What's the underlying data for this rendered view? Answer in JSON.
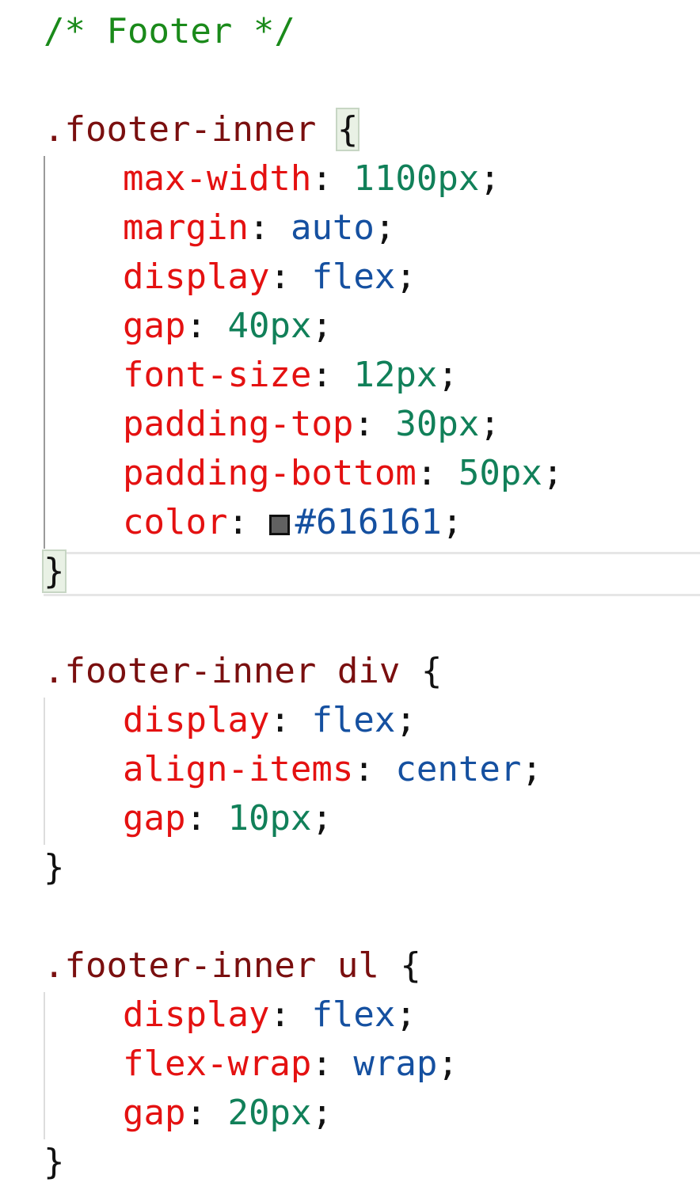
{
  "comment": "/* Footer */",
  "colors": {
    "comment": "#1a8a1a",
    "selector": "#7a0f0f",
    "property": "#e41111",
    "number": "#118059",
    "keyword": "#1550a0",
    "swatch": "#616161"
  },
  "rules": [
    {
      "selector": ".footer-inner",
      "open": "{",
      "close": "}",
      "declarations": [
        {
          "property": "max-width",
          "value": "1100px"
        },
        {
          "property": "margin",
          "value": "auto"
        },
        {
          "property": "display",
          "value": "flex"
        },
        {
          "property": "gap",
          "value": "40px"
        },
        {
          "property": "font-size",
          "value": "12px"
        },
        {
          "property": "padding-top",
          "value": "30px"
        },
        {
          "property": "padding-bottom",
          "value": "50px"
        },
        {
          "property": "color",
          "value": "#616161"
        }
      ]
    },
    {
      "selector": ".footer-inner div",
      "open": "{",
      "close": "}",
      "declarations": [
        {
          "property": "display",
          "value": "flex"
        },
        {
          "property": "align-items",
          "value": "center"
        },
        {
          "property": "gap",
          "value": "10px"
        }
      ]
    },
    {
      "selector": ".footer-inner ul",
      "open": "{",
      "close": "}",
      "declarations": [
        {
          "property": "display",
          "value": "flex"
        },
        {
          "property": "flex-wrap",
          "value": "wrap"
        },
        {
          "property": "gap",
          "value": "20px"
        }
      ]
    }
  ],
  "punct": {
    "colon": ":",
    "semicolon": ";"
  }
}
